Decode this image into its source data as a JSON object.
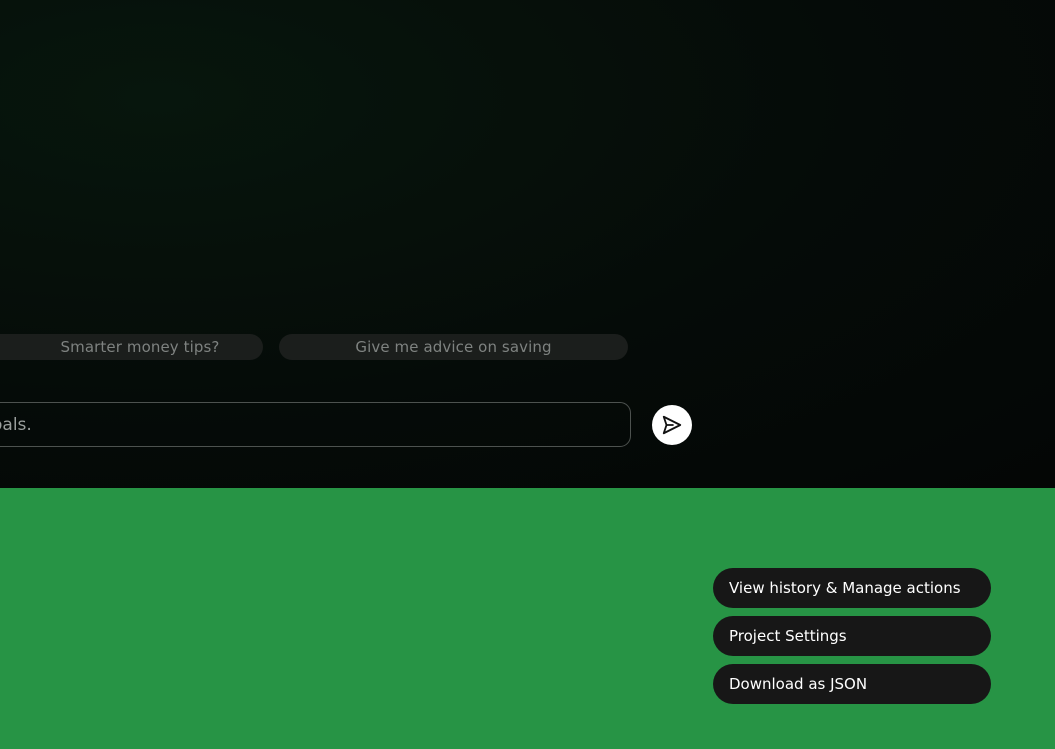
{
  "suggestions": [
    {
      "label": "Smarter money tips?"
    },
    {
      "label": "Give me advice on saving"
    }
  ],
  "chat_input": {
    "value": "g my goals."
  },
  "send_button": {
    "icon": "send-icon"
  },
  "actions": {
    "history_label": "View history & Manage actions",
    "settings_label": "Project Settings",
    "download_label": "Download as JSON"
  },
  "colors": {
    "footer_bg": "#279445",
    "button_bg": "#171717",
    "chat_bg": "#050b08"
  }
}
